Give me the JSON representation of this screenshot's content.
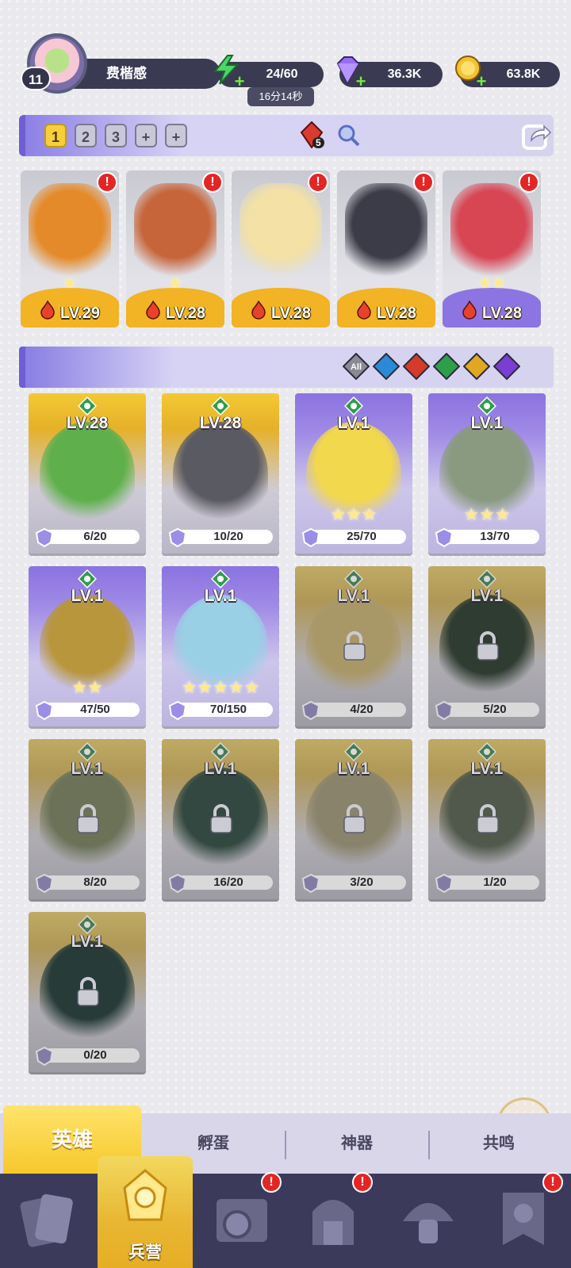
{
  "player": {
    "name": "费楷感",
    "level": "11"
  },
  "resources": {
    "energy": "24/60",
    "energy_timer": "16分14秒",
    "gems": "36.3K",
    "coins": "63.8K"
  },
  "team": {
    "tabs": [
      "1",
      "2",
      "3",
      "+",
      "+"
    ],
    "active_tab": "1",
    "power_count": "5"
  },
  "deployed": [
    {
      "level": "LV.29",
      "stars": "★",
      "base": "gold",
      "art_color": "#e58a2a"
    },
    {
      "level": "LV.28",
      "stars": "★",
      "base": "gold",
      "art_color": "#c7653a"
    },
    {
      "level": "LV.28",
      "stars": "",
      "base": "gold",
      "art_color": "#f3e1a6"
    },
    {
      "level": "LV.28",
      "stars": "",
      "base": "gold",
      "art_color": "#3c3c48"
    },
    {
      "level": "LV.28",
      "stars": "★★",
      "base": "purple",
      "art_color": "#d84654"
    }
  ],
  "filters": [
    {
      "name": "filter-all",
      "label": "All",
      "color": "#8a8a96"
    },
    {
      "name": "filter-water",
      "label": "",
      "color": "#2b8ad8"
    },
    {
      "name": "filter-fire",
      "label": "",
      "color": "#d63a2a"
    },
    {
      "name": "filter-nature",
      "label": "",
      "color": "#2f9e4a"
    },
    {
      "name": "filter-light",
      "label": "",
      "color": "#e0a820"
    },
    {
      "name": "filter-dark",
      "label": "",
      "color": "#7a3ed0"
    }
  ],
  "heroes": [
    {
      "level": "LV.28",
      "fragments": "6/20",
      "stars": "",
      "frame": "gold",
      "locked": false,
      "art_color": "#5fb04c"
    },
    {
      "level": "LV.28",
      "fragments": "10/20",
      "stars": "",
      "frame": "gold",
      "locked": false,
      "art_color": "#5a5a62"
    },
    {
      "level": "LV.1",
      "fragments": "25/70",
      "stars": "★★★",
      "frame": "purple",
      "locked": false,
      "art_color": "#f2d84c"
    },
    {
      "level": "LV.1",
      "fragments": "13/70",
      "stars": "★★★",
      "frame": "purple",
      "locked": false,
      "art_color": "#8a9a80"
    },
    {
      "level": "LV.1",
      "fragments": "47/50",
      "stars": "★★",
      "frame": "purple",
      "locked": false,
      "art_color": "#b8963c"
    },
    {
      "level": "LV.1",
      "fragments": "70/150",
      "stars": "★★★★★",
      "frame": "purple",
      "locked": false,
      "art_color": "#9ad0e6"
    },
    {
      "level": "LV.1",
      "fragments": "4/20",
      "stars": "",
      "frame": "gold",
      "locked": true,
      "art_color": "#d8b24a"
    },
    {
      "level": "LV.1",
      "fragments": "5/20",
      "stars": "",
      "frame": "gold",
      "locked": true,
      "art_color": "#2f4a32"
    },
    {
      "level": "LV.1",
      "fragments": "8/20",
      "stars": "",
      "frame": "gold",
      "locked": true,
      "art_color": "#7a8a52"
    },
    {
      "level": "LV.1",
      "fragments": "16/20",
      "stars": "",
      "frame": "gold",
      "locked": true,
      "art_color": "#2c5a4a"
    },
    {
      "level": "LV.1",
      "fragments": "3/20",
      "stars": "",
      "frame": "gold",
      "locked": true,
      "art_color": "#a89a6a"
    },
    {
      "level": "LV.1",
      "fragments": "1/20",
      "stars": "",
      "frame": "gold",
      "locked": true,
      "art_color": "#5a6a50"
    },
    {
      "level": "LV.1",
      "fragments": "0/20",
      "stars": "",
      "frame": "gold",
      "locked": true,
      "art_color": "#1f4a44"
    }
  ],
  "subtabs": {
    "heroes": "英雄",
    "hatch": "孵蛋",
    "artifacts": "神器",
    "resonance": "共鸣"
  },
  "nav": {
    "active_label": "兵营"
  },
  "colors": {
    "accent_gold": "#f6c82b",
    "accent_purple": "#8c74e3",
    "alert_red": "#e42525"
  }
}
